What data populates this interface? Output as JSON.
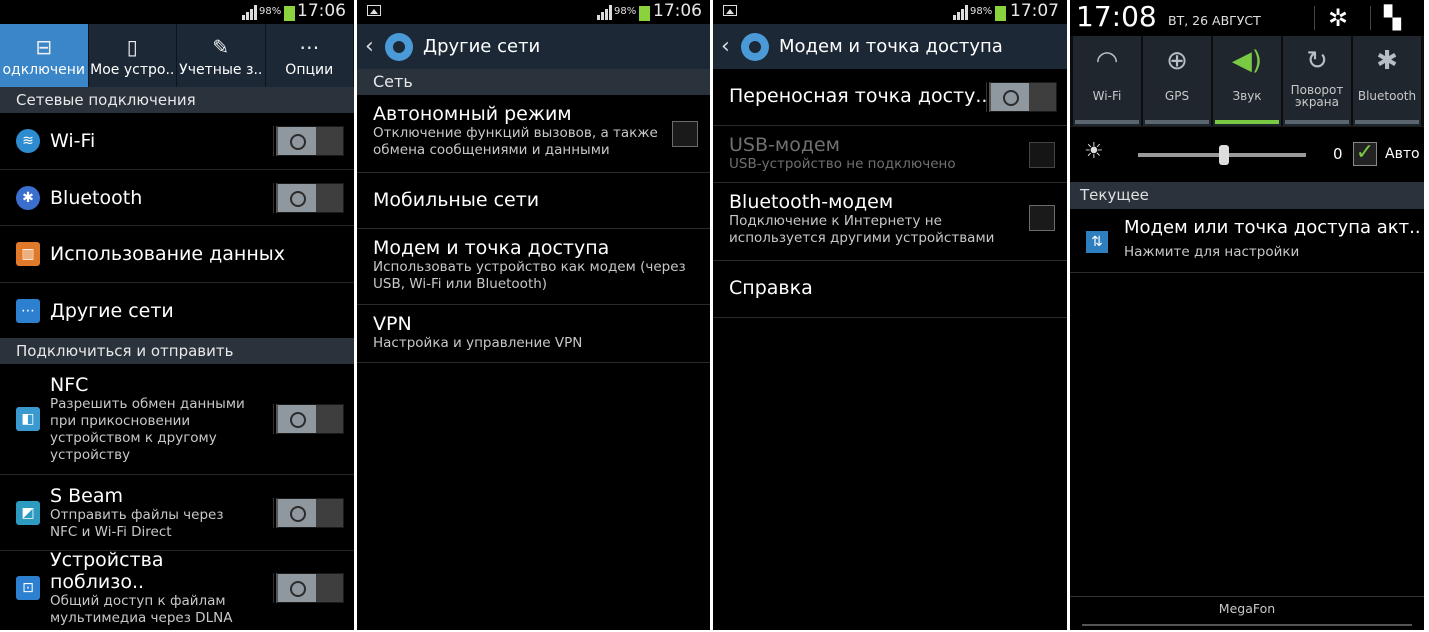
{
  "panel1": {
    "status": {
      "battery": "98%",
      "time": "17:06"
    },
    "tabs": [
      {
        "label": "одключени",
        "icon": "connections-icon"
      },
      {
        "label": "Мое устро..",
        "icon": "my-device-icon"
      },
      {
        "label": "Учетные з..",
        "icon": "accounts-icon"
      },
      {
        "label": "Опции",
        "icon": "more-options-icon"
      }
    ],
    "section1": "Сетевые подключения",
    "wifi": "Wi-Fi",
    "bluetooth": "Bluetooth",
    "data_usage": "Использование данных",
    "other_networks": "Другие сети",
    "section2": "Подключиться и отправить",
    "nfc": {
      "title": "NFC",
      "sub": "Разрешить обмен данными при прикосновении устройством к другому устройству"
    },
    "sbeam": {
      "title": "S Beam",
      "sub": "Отправить файлы через NFC и Wi-Fi Direct"
    },
    "nearby": {
      "title": "Устройства поблизо..",
      "sub": "Общий доступ к файлам мультимедиа через DLNA"
    }
  },
  "panel2": {
    "status": {
      "battery": "98%",
      "time": "17:06"
    },
    "title": "Другие сети",
    "section": "Сеть",
    "items": [
      {
        "title": "Автономный режим",
        "sub": "Отключение функций вызовов, а также обмена сообщениями и данными"
      },
      {
        "title": "Мобильные сети"
      },
      {
        "title": "Модем и точка доступа",
        "sub": "Использовать устройство как модем (через USB, Wi-Fi или Bluetooth)"
      },
      {
        "title": "VPN",
        "sub": "Настройка и управление VPN"
      }
    ]
  },
  "panel3": {
    "status": {
      "battery": "98%",
      "time": "17:07"
    },
    "title": "Модем и точка доступа",
    "hotspot": "Переносная точка досту..",
    "usb": {
      "title": "USB-модем",
      "sub": "USB-устройство не подключено"
    },
    "bt": {
      "title": "Bluetooth-модем",
      "sub": "Подключение к Интернету не используется другими устройствами"
    },
    "help": "Справка"
  },
  "panel4": {
    "time": "17:08",
    "date": "ВТ, 26 АВГУСТ",
    "quick": [
      {
        "label": "Wi-Fi",
        "icon": "wifi-icon",
        "on": false
      },
      {
        "label": "GPS",
        "icon": "gps-icon",
        "on": false
      },
      {
        "label": "Звук",
        "icon": "sound-icon",
        "on": true
      },
      {
        "label": "Поворот экрана",
        "icon": "rotate-icon",
        "on": false
      },
      {
        "label": "Bluetooth",
        "icon": "bluetooth-icon",
        "on": false
      }
    ],
    "brightness_value": "0",
    "auto_label": "Авто",
    "current_header": "Текущее",
    "notification": {
      "title": "Модем или точка доступа акт..",
      "sub": "Нажмите для настройки"
    },
    "carrier": "MegaFon"
  },
  "colors": {
    "accent": "#3a86c8",
    "green": "#7ac943",
    "bar": "#1c2836"
  }
}
